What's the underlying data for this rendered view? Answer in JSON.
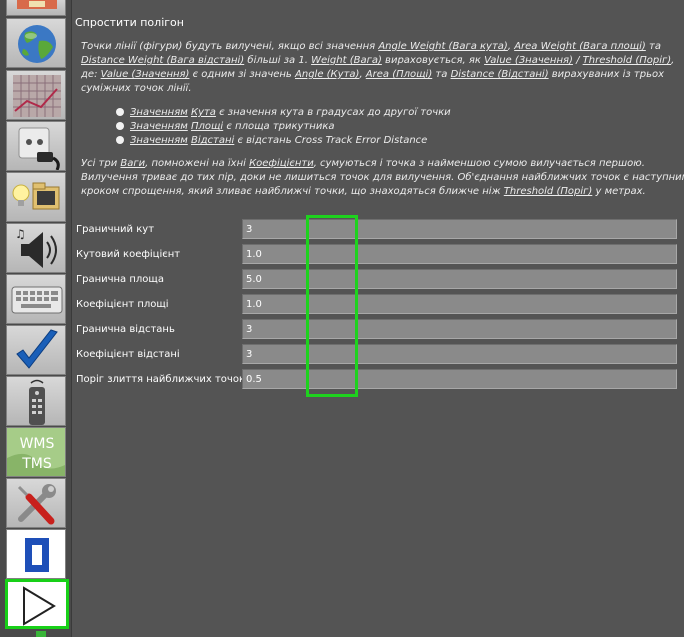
{
  "panel": {
    "title": "Спростити полігон",
    "intro_lines": [
      [
        {
          "t": "Точки лінії (фігури) будуть вилучені, якщо всі значення "
        },
        {
          "t": "Angle Weight (Вага кута)",
          "u": true
        },
        {
          "t": ", "
        },
        {
          "t": "Area Weight (Вага площі)",
          "u": true
        },
        {
          "t": " та"
        }
      ],
      [
        {
          "t": "Distance Weight (Вага відстані)",
          "u": true
        },
        {
          "t": " більші за 1. "
        },
        {
          "t": "Weight (Вага)",
          "u": true
        },
        {
          "t": " вираховується, як "
        },
        {
          "t": "Value (Значення)",
          "u": true
        },
        {
          "t": " / "
        },
        {
          "t": "Threshold (Поріг)",
          "u": true
        },
        {
          "t": ","
        }
      ],
      [
        {
          "t": "де: "
        },
        {
          "t": "Value (Значення)",
          "u": true
        },
        {
          "t": " є одним зі значень "
        },
        {
          "t": "Angle (Кута)",
          "u": true
        },
        {
          "t": ", "
        },
        {
          "t": "Area (Площі)",
          "u": true
        },
        {
          "t": " та "
        },
        {
          "t": "Distance (Відстані)",
          "u": true
        },
        {
          "t": " вирахуваних із трьох"
        }
      ],
      [
        {
          "t": "суміжних точок лінії."
        }
      ]
    ],
    "bullets": [
      [
        {
          "t": "Значенням",
          "u": true
        },
        {
          "t": " "
        },
        {
          "t": "Кута",
          "u": true
        },
        {
          "t": " є значення кута в градусах до другої точки"
        }
      ],
      [
        {
          "t": "Значенням",
          "u": true
        },
        {
          "t": " "
        },
        {
          "t": "Площі",
          "u": true
        },
        {
          "t": " є площа трикутника"
        }
      ],
      [
        {
          "t": "Значенням",
          "u": true
        },
        {
          "t": " "
        },
        {
          "t": "Відстані",
          "u": true
        },
        {
          "t": " є відстань Cross Track Error Distance"
        }
      ]
    ],
    "outro_lines": [
      [
        {
          "t": "Усі три "
        },
        {
          "t": "Ваги",
          "u": true
        },
        {
          "t": ", помножені на їхні "
        },
        {
          "t": "Коефіцієнти",
          "u": true
        },
        {
          "t": ", сумуються і точка з найменшою сумою вилучається першою."
        }
      ],
      [
        {
          "t": "Вилучення триває до тих пір, доки не лишиться точок для вилучення. Об'єднання найближчих точок є наступним"
        }
      ],
      [
        {
          "t": "кроком спрощення, який зливає найближчі точки, що знаходяться ближче ніж "
        },
        {
          "t": "Threshold (Поріг)",
          "u": true
        },
        {
          "t": " у метрах."
        }
      ]
    ]
  },
  "fields": [
    {
      "label": "Граничний кут",
      "value": "3"
    },
    {
      "label": "Кутовий коефіцієнт",
      "value": "1.0"
    },
    {
      "label": "Гранична площа",
      "value": "5.0"
    },
    {
      "label": "Коефіцієнт площі",
      "value": "1.0"
    },
    {
      "label": "Гранична відстань",
      "value": "3"
    },
    {
      "label": "Коефіцієнт відстані",
      "value": "3"
    },
    {
      "label": "Поріг злиття найближчих точок",
      "value": "0.5"
    }
  ],
  "toolbar": {
    "items": [
      {
        "icon": "tools-top-icon"
      },
      {
        "icon": "globe-icon"
      },
      {
        "icon": "map-grid-icon"
      },
      {
        "icon": "power-plug-icon"
      },
      {
        "icon": "folder-lightbulb-icon"
      },
      {
        "icon": "speaker-music-icon"
      },
      {
        "icon": "keyboard-icon"
      },
      {
        "icon": "checkmark-icon"
      },
      {
        "icon": "remote-control-icon"
      },
      {
        "icon": "wms-tms-icon",
        "text": [
          "WMS",
          "TMS"
        ]
      },
      {
        "icon": "wrench-screwdriver-icon"
      },
      {
        "icon": "zero-digit-icon",
        "text": [
          "0"
        ]
      },
      {
        "icon": "play-triangle-icon",
        "selected": true
      }
    ]
  },
  "colors": {
    "background": "#545454",
    "input_background": "#8a8a8a",
    "highlight": "#1ed21e"
  }
}
